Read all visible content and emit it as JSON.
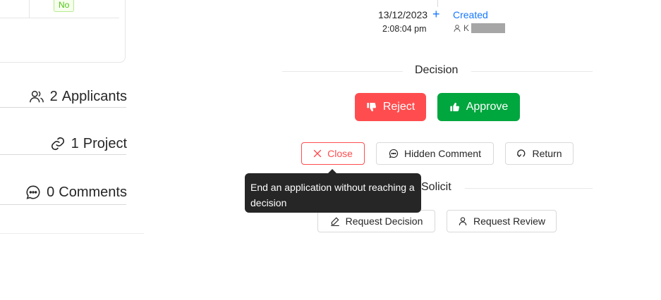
{
  "left_panel": {
    "badge_no": "No",
    "applicants": {
      "count": "2",
      "label": "Applicants",
      "icon": "users-icon"
    },
    "project": {
      "count": "1",
      "label": "Project",
      "icon": "link-icon"
    },
    "comments": {
      "count": "0",
      "label": "Comments",
      "icon": "comment-icon"
    }
  },
  "timeline": {
    "date": "13/12/2023",
    "time": "2:08:04 pm",
    "event": "Created",
    "user_initial": "K"
  },
  "decision": {
    "title": "Decision",
    "reject_label": "Reject",
    "approve_label": "Approve"
  },
  "actions": {
    "close_label": "Close",
    "hidden_comment_label": "Hidden Comment",
    "return_label": "Return"
  },
  "tooltip": {
    "text": "End an application without reaching a decision"
  },
  "solicit": {
    "title": "Solicit",
    "request_decision_label": "Request Decision",
    "request_review_label": "Request Review"
  },
  "colors": {
    "danger": "#ff4d4f",
    "success": "#00a63e",
    "link": "#1677ff",
    "tooltip_bg": "#262626"
  }
}
